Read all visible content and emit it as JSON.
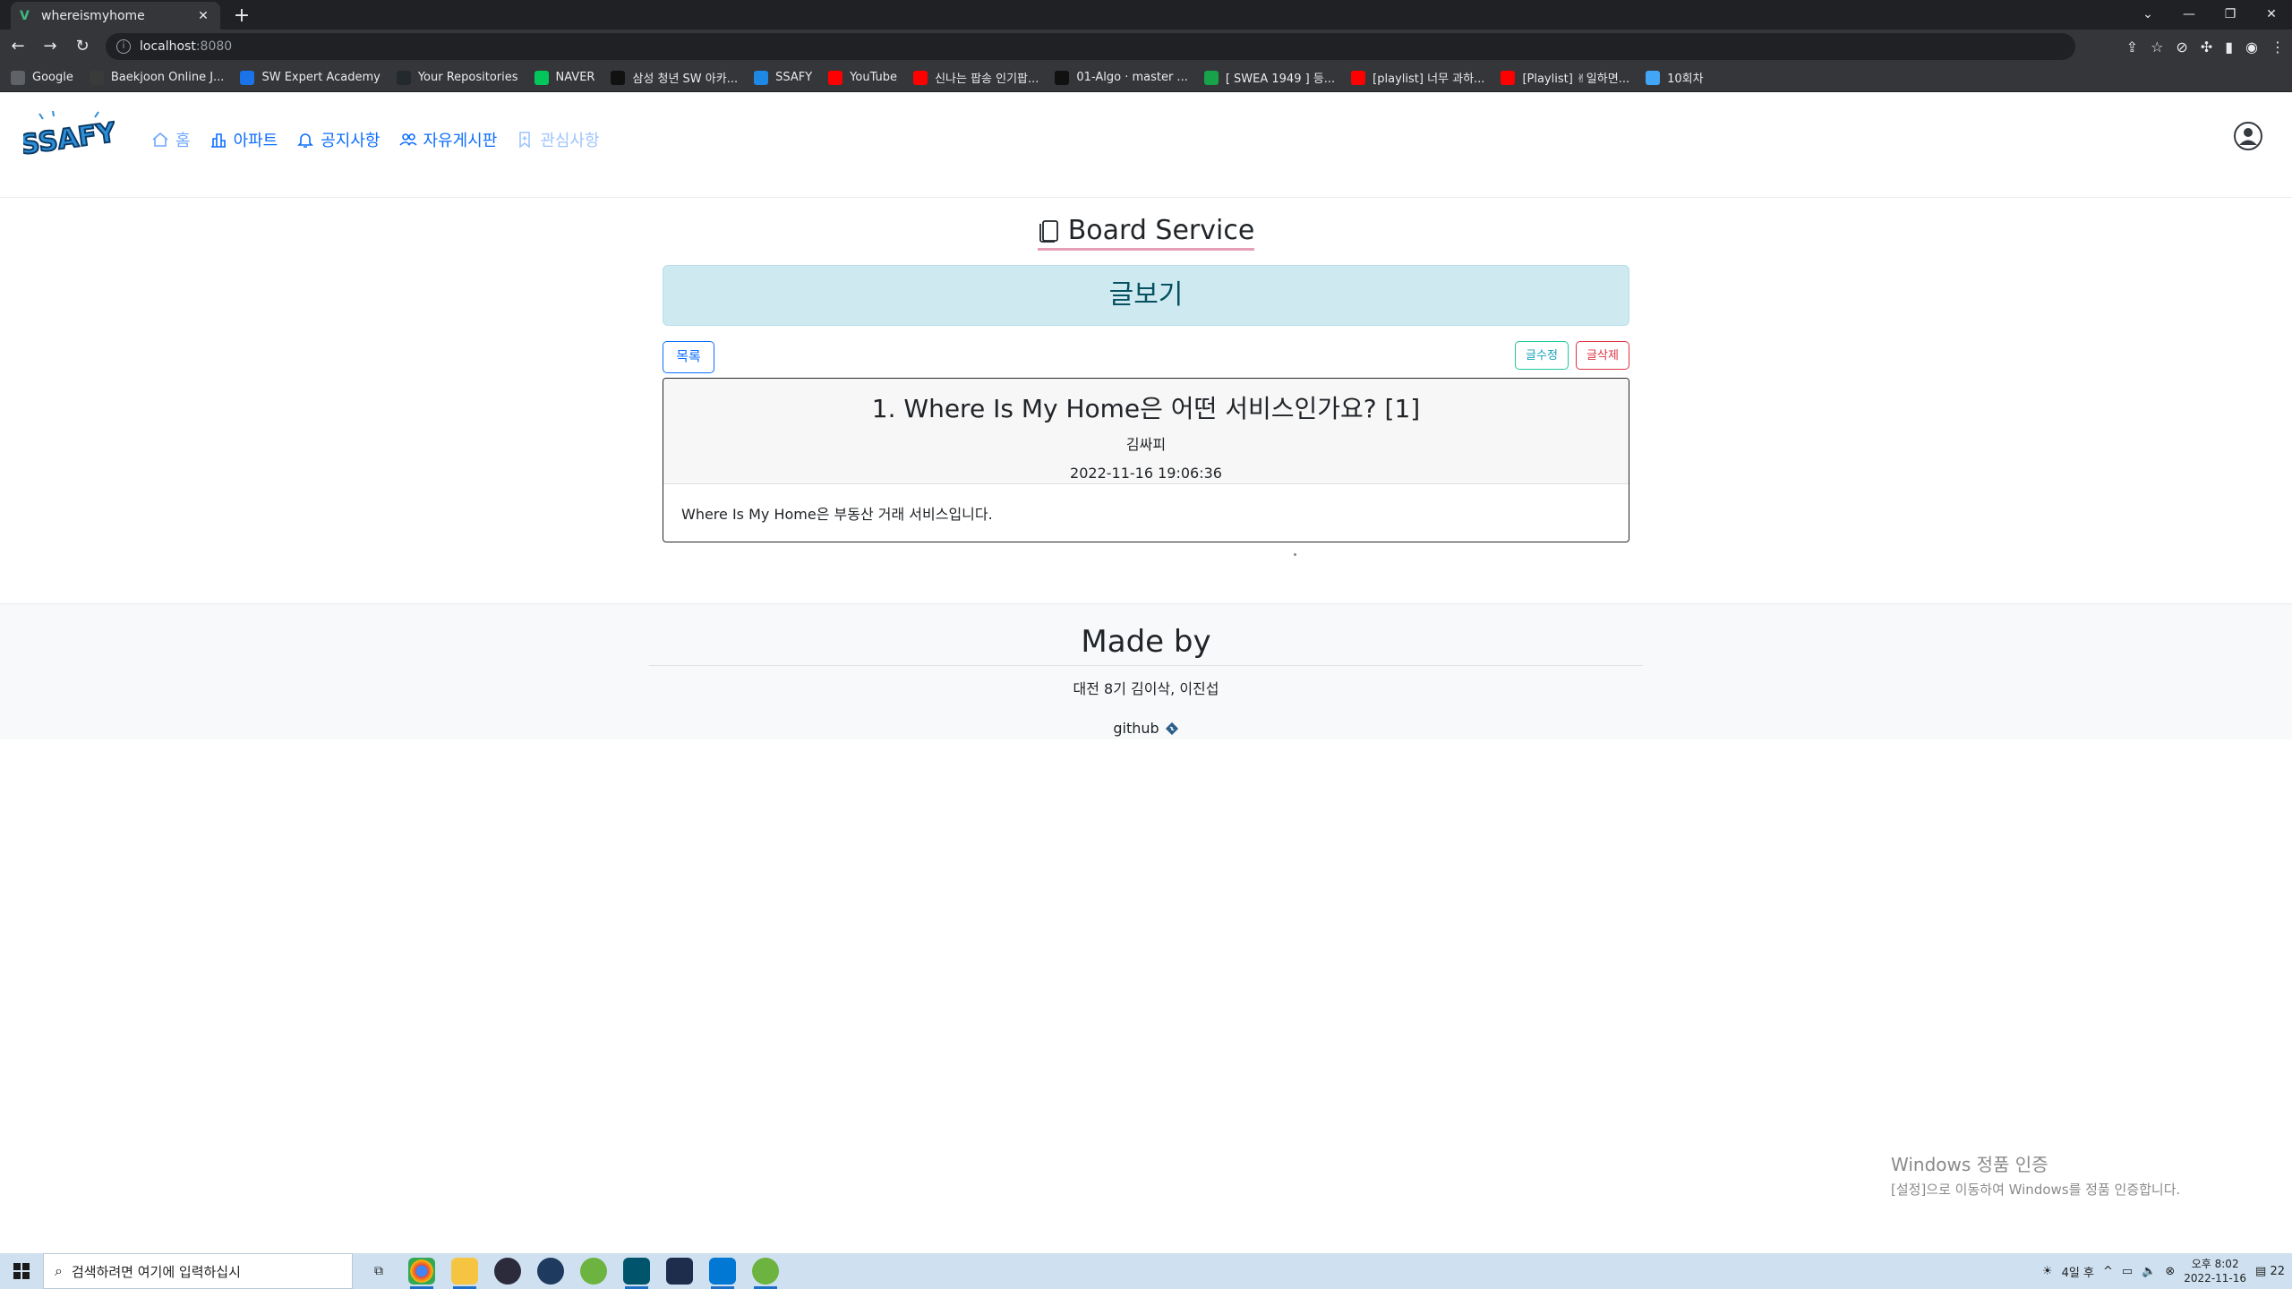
{
  "browser": {
    "tab_title": "whereismyhome",
    "url_host": "localhost",
    "url_port": ":8080",
    "bookmarks": [
      {
        "label": "Google",
        "color": "#5f6368"
      },
      {
        "label": "Baekjoon Online J...",
        "color": "#3a3a3a"
      },
      {
        "label": "SW Expert Academy",
        "color": "#1a73e8"
      },
      {
        "label": "Your Repositories",
        "color": "#24292e"
      },
      {
        "label": "NAVER",
        "color": "#03c75a"
      },
      {
        "label": "삼성 청년 SW 아카...",
        "color": "#111111"
      },
      {
        "label": "SSAFY",
        "color": "#1e88e5"
      },
      {
        "label": "YouTube",
        "color": "#ff0000"
      },
      {
        "label": "신나는 팝송 인기팝...",
        "color": "#ff0000"
      },
      {
        "label": "01-Algo · master ...",
        "color": "#111111"
      },
      {
        "label": "[ SWEA 1949 ] 등...",
        "color": "#16a34a"
      },
      {
        "label": "[playlist] 너무 과하...",
        "color": "#ff0000"
      },
      {
        "label": "[Playlist] ✌일하면...",
        "color": "#ff0000"
      },
      {
        "label": "10회차",
        "color": "#42a5f5"
      }
    ]
  },
  "header": {
    "logo_text": "SSAFY",
    "nav": [
      {
        "label": "홈",
        "icon": "home-icon"
      },
      {
        "label": "아파트",
        "icon": "building-icon"
      },
      {
        "label": "공지사항",
        "icon": "bell-icon"
      },
      {
        "label": "자유게시판",
        "icon": "people-icon"
      },
      {
        "label": "관심사항",
        "icon": "bookmark-icon"
      }
    ]
  },
  "page": {
    "section_title": "Board Service",
    "banner": "글보기",
    "list_button": "목록",
    "edit_button": "글수정",
    "delete_button": "글삭제"
  },
  "article": {
    "title": "1. Where Is My Home은 어떤 서비스인가요? [1]",
    "author": "김싸피",
    "date": "2022-11-16 19:06:36",
    "content": "Where Is My Home은 부동산 거래 서비스입니다."
  },
  "footer": {
    "heading": "Made by",
    "members": "대전 8기 김이삭, 이진섭",
    "github_label": "github"
  },
  "watermark": {
    "line1": "Windows 정품 인증",
    "line2": "[설정]으로 이동하여 Windows를 정품 인증합니다."
  },
  "taskbar": {
    "search_placeholder": "검색하려면 여기에 입력하십시",
    "weather": "4일 후",
    "time": "오후 8:02",
    "date": "2022-11-16",
    "notification_count": "22"
  }
}
